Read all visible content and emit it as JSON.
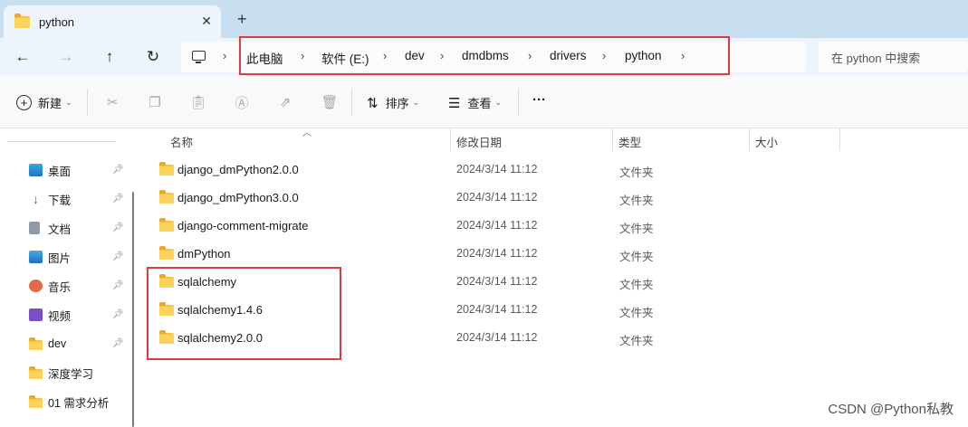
{
  "tab": {
    "title": "python",
    "close": "✕",
    "new_tab": "+"
  },
  "nav": {
    "back": "←",
    "forward": "→",
    "up": "↑",
    "refresh": "↻"
  },
  "breadcrumb": {
    "separator": "›",
    "items": [
      "此电脑",
      "软件 (E:)",
      "dev",
      "dmdbms",
      "drivers",
      "python"
    ]
  },
  "search": {
    "placeholder": "在 python 中搜索"
  },
  "toolbar": {
    "new_label": "新建",
    "sort_label": "排序",
    "view_label": "查看",
    "more": "···"
  },
  "sidebar": {
    "items": [
      {
        "label": "桌面",
        "icon": "desktop-icon",
        "pinned": true
      },
      {
        "label": "下载",
        "icon": "download-icon",
        "pinned": true
      },
      {
        "label": "文档",
        "icon": "document-icon",
        "pinned": true
      },
      {
        "label": "图片",
        "icon": "pictures-icon",
        "pinned": true
      },
      {
        "label": "音乐",
        "icon": "music-icon",
        "pinned": true
      },
      {
        "label": "视频",
        "icon": "video-icon",
        "pinned": true
      },
      {
        "label": "dev",
        "icon": "folder-icon",
        "pinned": true
      },
      {
        "label": "深度学习",
        "icon": "folder-icon",
        "pinned": false
      },
      {
        "label": "01 需求分析",
        "icon": "folder-icon",
        "pinned": false
      }
    ]
  },
  "columns": {
    "name": "名称",
    "modified": "修改日期",
    "type": "类型",
    "size": "大小"
  },
  "files": [
    {
      "name": "django_dmPython2.0.0",
      "modified": "2024/3/14 11:12",
      "type": "文件夹"
    },
    {
      "name": "django_dmPython3.0.0",
      "modified": "2024/3/14 11:12",
      "type": "文件夹"
    },
    {
      "name": "django-comment-migrate",
      "modified": "2024/3/14 11:12",
      "type": "文件夹"
    },
    {
      "name": "dmPython",
      "modified": "2024/3/14 11:12",
      "type": "文件夹"
    },
    {
      "name": "sqlalchemy",
      "modified": "2024/3/14 11:12",
      "type": "文件夹"
    },
    {
      "name": "sqlalchemy1.4.6",
      "modified": "2024/3/14 11:12",
      "type": "文件夹"
    },
    {
      "name": "sqlalchemy2.0.0",
      "modified": "2024/3/14 11:12",
      "type": "文件夹"
    }
  ],
  "watermark": "CSDN @Python私教",
  "colors": {
    "highlight_box": "#e23b3b",
    "folder": "#f5c443",
    "titlebar": "#c8dff2"
  }
}
